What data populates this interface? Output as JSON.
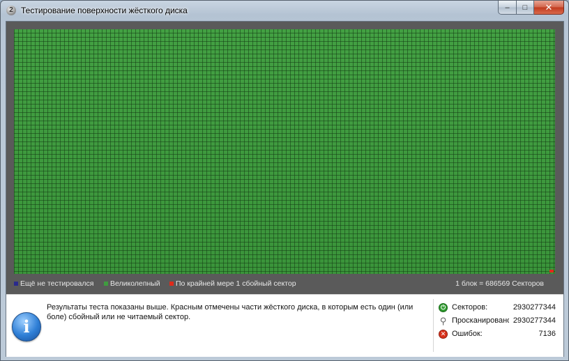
{
  "window": {
    "title": "Тестирование поверхности жёсткого диска",
    "app_icon_glyph": "2",
    "buttons": {
      "minimize": "–",
      "maximize": "□",
      "close": "✕"
    }
  },
  "surface_map": {
    "status_colors": {
      "good": "#3f9c3f",
      "untested": "#2a2a8c",
      "bad": "#e02a1a"
    },
    "legend": {
      "untested": "Ещё не тестировался",
      "excellent": "Великолепный",
      "bad": "По крайней мере 1 сбойный сектор",
      "block_info": "1 блок = 686569 Секторов"
    }
  },
  "info": {
    "icon": "info-icon",
    "message": "Результаты теста показаны выше. Красным отмечены части жёсткого диска, в которым есть один (или боле) сбойный или не читаемый сектор."
  },
  "stats": {
    "sectors_label": "Секторов:",
    "sectors_value": "2930277344",
    "scanned_label": "Просканировано",
    "scanned_value": "2930277344",
    "errors_label": "Ошибок:",
    "errors_value": "7136"
  }
}
